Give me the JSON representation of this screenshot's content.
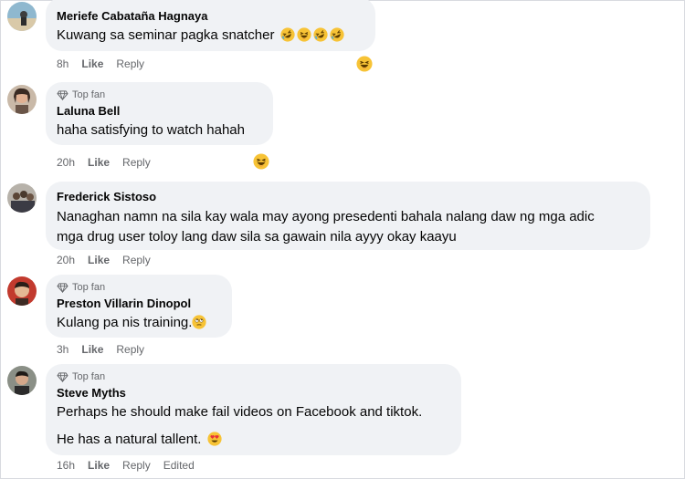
{
  "comments": [
    {
      "author": "Meriefe Cabataña Hagnaya",
      "text": "Kuwang sa seminar pagka snatcher",
      "text_emojis": [
        "rofl-emoji",
        "grin-emoji",
        "rofl-emoji",
        "rofl-emoji"
      ],
      "time": "8h",
      "like": "Like",
      "reply": "Reply",
      "reaction": "haha-reaction"
    },
    {
      "badge": "Top fan",
      "author": "Laluna Bell",
      "text": "haha satisfying to watch hahah",
      "time": "20h",
      "like": "Like",
      "reply": "Reply",
      "reaction": "haha-reaction"
    },
    {
      "author": "Frederick Sistoso",
      "text_line1": "Nanaghan namn na sila kay wala may ayong presedenti bahala nalang daw ng mga adic",
      "text_line2": "mga drug user toloy lang daw sila sa gawain nila ayyy okay kaayu",
      "time": "20h",
      "like": "Like",
      "reply": "Reply"
    },
    {
      "badge": "Top fan",
      "author": "Preston Villarin Dinopol",
      "text": "Kulang pa nis training.",
      "text_emojis": [
        "eye-roll-emoji"
      ],
      "time": "3h",
      "like": "Like",
      "reply": "Reply"
    },
    {
      "badge": "Top fan",
      "author": "Steve Myths",
      "text": "Perhaps he should make fail videos on Facebook and tiktok.",
      "text_para2": "He has a natural tallent.",
      "text_emojis": [
        "heart-eyes-emoji"
      ],
      "time": "16h",
      "like": "Like",
      "reply": "Reply",
      "edited": "Edited"
    }
  ],
  "colors": {
    "bubble": "#f0f2f5",
    "secondary_text": "#65676b",
    "emoji_yellow": "#f7c336"
  }
}
